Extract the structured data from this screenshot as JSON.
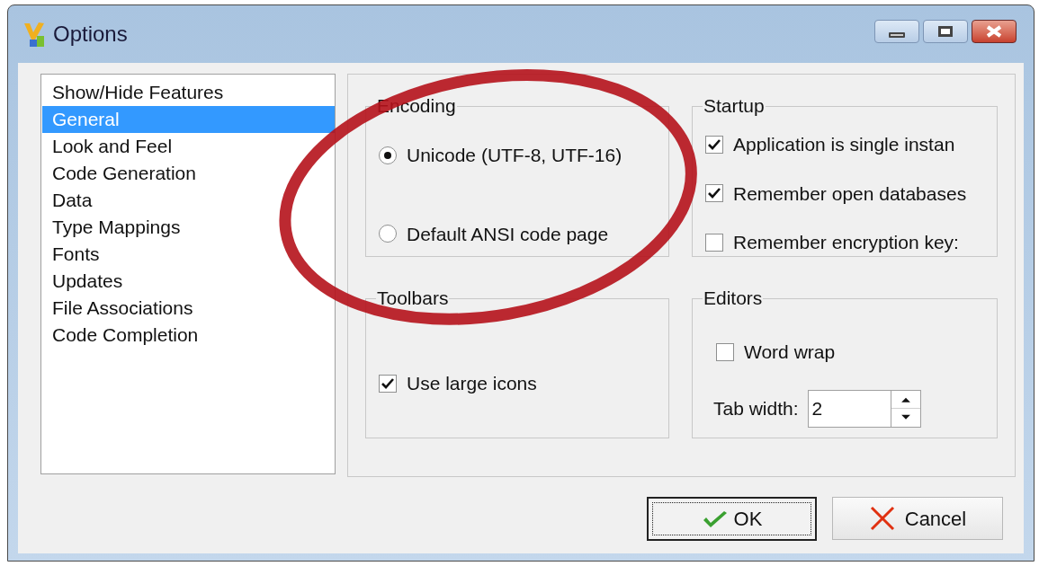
{
  "window": {
    "title": "Options"
  },
  "sidebar": {
    "items": [
      {
        "label": "Show/Hide Features",
        "selected": false
      },
      {
        "label": "General",
        "selected": true
      },
      {
        "label": "Look and Feel",
        "selected": false
      },
      {
        "label": "Code Generation",
        "selected": false
      },
      {
        "label": "Data",
        "selected": false
      },
      {
        "label": "Type Mappings",
        "selected": false
      },
      {
        "label": "Fonts",
        "selected": false
      },
      {
        "label": "Updates",
        "selected": false
      },
      {
        "label": "File Associations",
        "selected": false
      },
      {
        "label": "Code Completion",
        "selected": false
      }
    ]
  },
  "encoding": {
    "title": "Encoding",
    "options": [
      {
        "label": "Unicode (UTF-8, UTF-16)",
        "selected": true
      },
      {
        "label": "Default ANSI code page",
        "selected": false
      }
    ]
  },
  "startup": {
    "title": "Startup",
    "options": [
      {
        "label": "Application is single instan",
        "checked": true
      },
      {
        "label": "Remember open databases",
        "checked": true
      },
      {
        "label": "Remember encryption key:",
        "checked": false
      }
    ]
  },
  "toolbars": {
    "title": "Toolbars",
    "options": [
      {
        "label": "Use large icons",
        "checked": true
      }
    ]
  },
  "editors": {
    "title": "Editors",
    "options": [
      {
        "label": "Word wrap",
        "checked": false
      }
    ],
    "tab_width": {
      "label": "Tab width:",
      "value": "2"
    }
  },
  "buttons": [
    {
      "label": "OK",
      "kind": "ok",
      "default": true
    },
    {
      "label": "Cancel",
      "kind": "cancel",
      "default": false
    }
  ]
}
